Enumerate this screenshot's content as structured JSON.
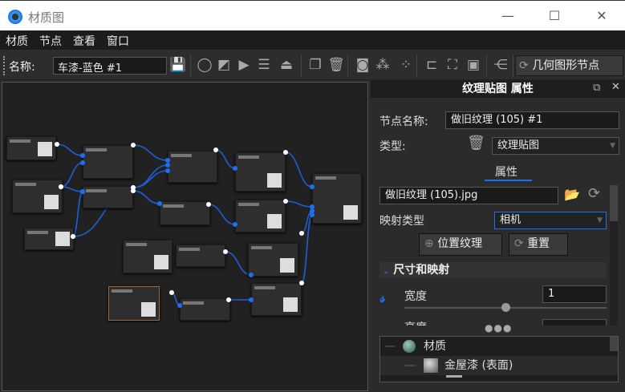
{
  "window": {
    "title": "材质图",
    "minimize": "—",
    "maximize": "☐",
    "close": "✕"
  },
  "menu": [
    "材质",
    "节点",
    "查看",
    "窗口"
  ],
  "toolbar": {
    "name_label": "名称:",
    "name_value": "车漆-蓝色 #1",
    "geometry_button": "几何图形节点",
    "icons": [
      "save-icon",
      "sphere-preview-icon",
      "checker-icon",
      "play-icon",
      "sliders-icon",
      "weight-icon",
      "copy-icon",
      "trash-icon",
      "node-a-icon",
      "node-b-icon",
      "node-c-icon",
      "layout-icon",
      "fit-icon",
      "zoom-100-icon",
      "split-icon"
    ]
  },
  "panel": {
    "title": "纹理贴图 属性",
    "node_name_label": "节点名称:",
    "node_name_value": "做旧纹理 (105) #1",
    "type_label": "类型:",
    "type_value": "纹理贴图",
    "tab": "属性",
    "file_value": "做旧纹理 (105).jpg",
    "mapping_label": "映射类型",
    "mapping_value": "相机",
    "place_button": "位置纹理",
    "reset_button": "重置",
    "section": "尺寸和映射",
    "width_label": "宽度",
    "width_value": "1",
    "width_slider": 0.5,
    "height_label_partial": "高度",
    "accent": "#1e6ff0",
    "tree": [
      {
        "label": "材质",
        "level": 0
      },
      {
        "label": "金屋漆 (表面)",
        "level": 1
      }
    ]
  }
}
